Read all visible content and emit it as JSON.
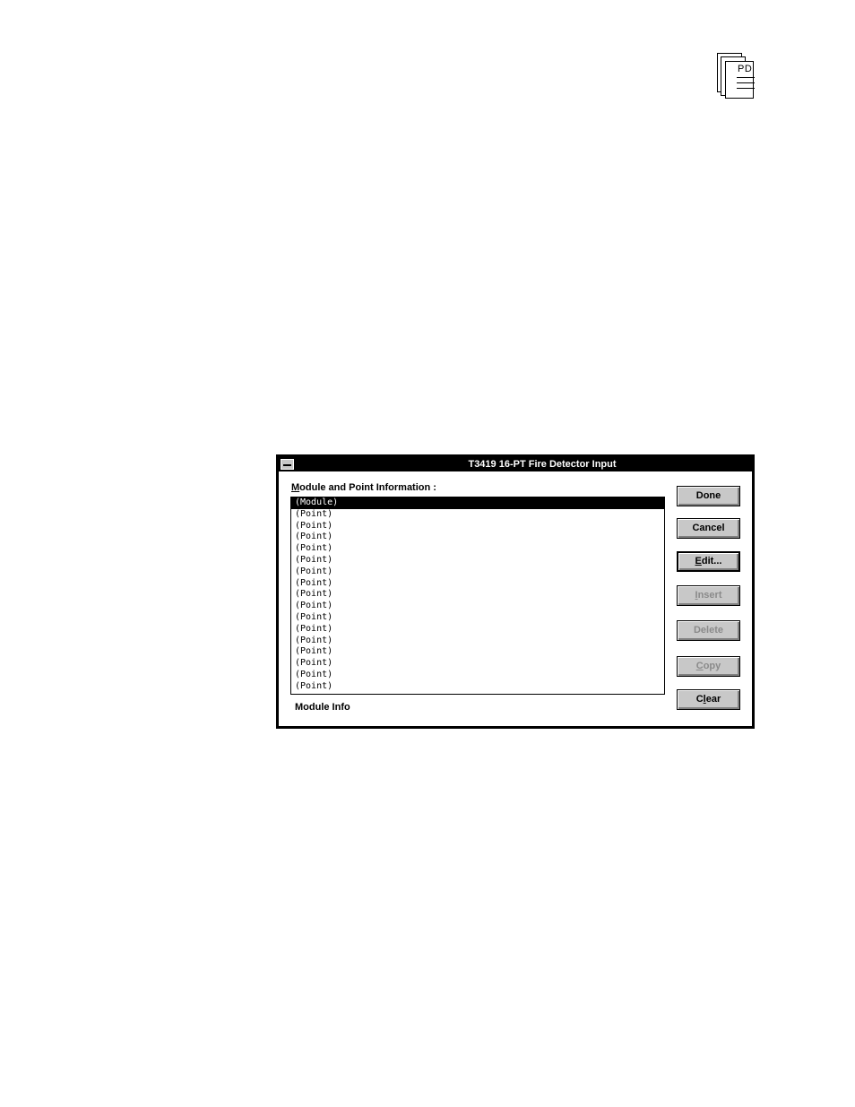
{
  "page": {
    "corner_icon_text": "PD"
  },
  "dialog": {
    "title": "T3419 16-PT  Fire Detector Input",
    "list_label_mnemonic": "M",
    "list_label_rest": "odule and Point Information :",
    "list_items": [
      "(Module)",
      "(Point)",
      "(Point)",
      "(Point)",
      "(Point)",
      "(Point)",
      "(Point)",
      "(Point)",
      "(Point)",
      "(Point)",
      "(Point)",
      "(Point)",
      "(Point)",
      "(Point)",
      "(Point)",
      "(Point)",
      "(Point)"
    ],
    "selected_index": 0,
    "status_text": "Module Info",
    "buttons": {
      "done": {
        "label": "Done",
        "enabled": true
      },
      "cancel": {
        "label": "Cancel",
        "enabled": true
      },
      "edit": {
        "mnemonic": "E",
        "rest": "dit...",
        "enabled": true,
        "default": true
      },
      "insert": {
        "mnemonic": "I",
        "rest": "nsert",
        "enabled": false
      },
      "delete": {
        "mnemonic": "",
        "rest": "Delete",
        "enabled": false
      },
      "copy": {
        "mnemonic": "C",
        "rest": "opy",
        "enabled": false
      },
      "clear": {
        "pre": "C",
        "mnemonic": "l",
        "rest": "ear",
        "enabled": true
      }
    }
  }
}
